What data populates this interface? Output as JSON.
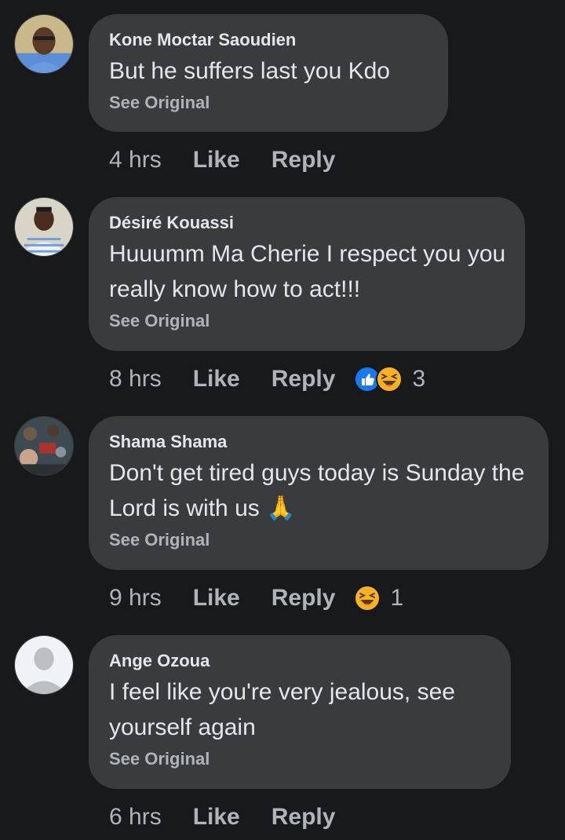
{
  "comments": [
    {
      "author": "Kone Moctar Saoudien",
      "text": "But he suffers last you Kdo",
      "see_original": "See Original",
      "time": "4 hrs",
      "like": "Like",
      "reply": "Reply",
      "reactions": [],
      "reaction_count": ""
    },
    {
      "author": "Désiré Kouassi",
      "text": "Huuumm Ma Cherie I respect you you really know how to act!!!",
      "see_original": "See Original",
      "time": "8 hrs",
      "like": "Like",
      "reply": "Reply",
      "reactions": [
        "like-reaction-icon",
        "haha-reaction-icon"
      ],
      "reaction_count": "3"
    },
    {
      "author": "Shama Shama",
      "text": "Don't get tired guys today is Sunday the Lord is with us 🙏",
      "see_original": "See Original",
      "time": "9 hrs",
      "like": "Like",
      "reply": "Reply",
      "reactions": [
        "haha-reaction-icon"
      ],
      "reaction_count": "1"
    },
    {
      "author": "Ange Ozoua",
      "text": "I feel like you're very jealous, see yourself again",
      "see_original": "See Original",
      "time": "6 hrs",
      "like": "Like",
      "reply": "Reply",
      "reactions": [],
      "reaction_count": ""
    }
  ],
  "colors": {
    "background": "#18191a",
    "bubble": "#3a3b3c",
    "primary_text": "#e4e6eb",
    "secondary_text": "#b0b3b8",
    "like_blue": "#1877f2",
    "haha_yellow": "#f7b125"
  }
}
